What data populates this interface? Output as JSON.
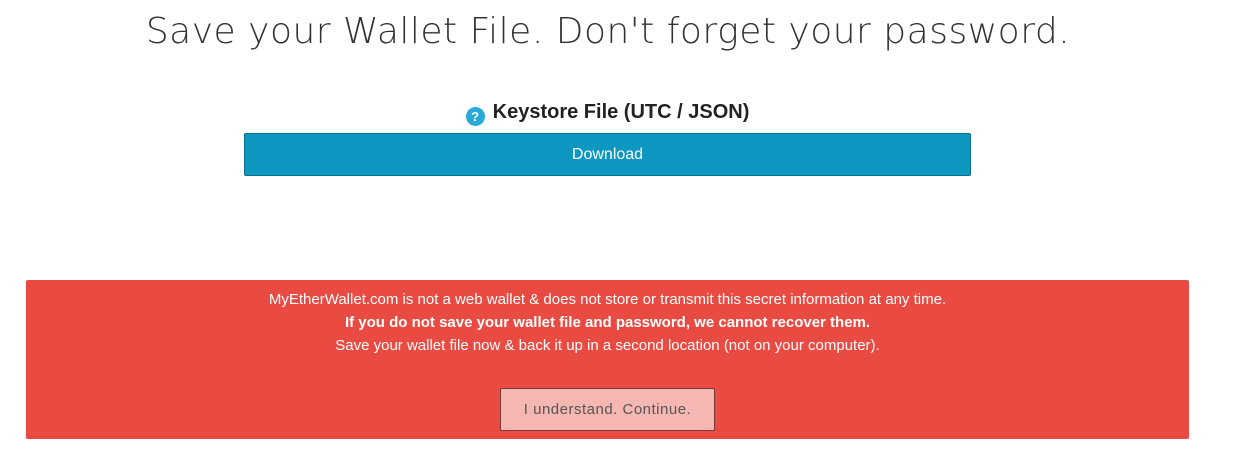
{
  "header": {
    "title": "Save your Wallet File. Don't forget your password."
  },
  "keystore": {
    "help_icon": "question-circle-icon",
    "help_glyph": "?",
    "heading": "Keystore File (UTC / JSON)",
    "download_label": "Download"
  },
  "warning": {
    "line1": "MyEtherWallet.com is not a web wallet & does not store or transmit this secret information at any time.",
    "line2": "If you do not save your wallet file and password, we cannot recover them.",
    "line3": "Save your wallet file now & back it up in a second location (not on your computer).",
    "continue_label": "I understand. Continue."
  },
  "colors": {
    "primary_button": "#0e97c0",
    "help_icon": "#29a9d6",
    "warning_background": "#e94b42",
    "continue_button": "#f6b6b2"
  }
}
